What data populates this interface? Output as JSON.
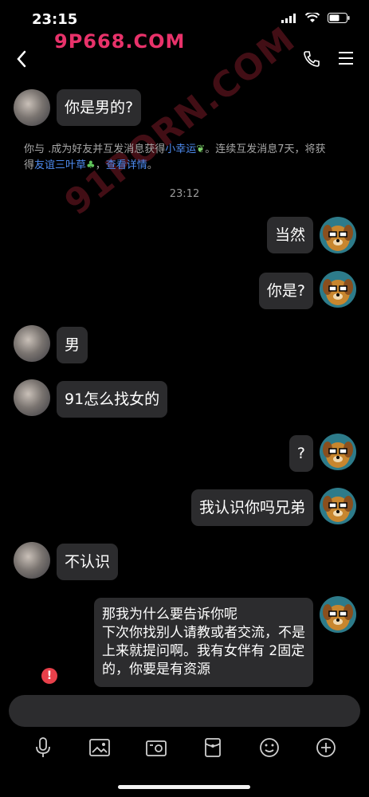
{
  "status_bar": {
    "time": "23:15"
  },
  "watermarks": {
    "top": "9P668.COM",
    "diagonal": "91PORN.COM"
  },
  "chat": {
    "messages": [
      {
        "side": "left",
        "text": "你是男的?"
      },
      {
        "side": "right",
        "text": "当然"
      },
      {
        "side": "right",
        "text": "你是?"
      },
      {
        "side": "left",
        "text": "男"
      },
      {
        "side": "left",
        "text": "91怎么找女的"
      },
      {
        "side": "right",
        "text": "?"
      },
      {
        "side": "right",
        "text": "我认识你吗兄弟"
      },
      {
        "side": "left",
        "text": "不认识"
      },
      {
        "side": "right",
        "lines": [
          "那我为什么要告诉你呢",
          "下次你找别人请教或者交流，不是",
          "上来就提问啊。我有女伴有 2固定",
          "的，你要是有资源"
        ],
        "failed": true
      }
    ],
    "system_note": {
      "part1": "你与 .成为好友并互发消息获得",
      "link1": "小幸运",
      "part2": "。连续互发消息7天，将获",
      "part3": "得",
      "link2": "友谊三叶草",
      "part4": "，",
      "link3": "查看详情",
      "part5": "。"
    },
    "timestamp": "23:12"
  },
  "colors": {
    "background": "#000000",
    "bubble": "#2c2c2e",
    "link": "#4e8cf1",
    "error": "#e8404a",
    "watermark": "#e8326a"
  },
  "icons": {
    "nav": [
      "back-arrow-icon",
      "phone-icon",
      "menu-icon"
    ],
    "toolbar": [
      "microphone-icon",
      "image-icon",
      "camera-icon",
      "red-packet-icon",
      "emoji-icon",
      "plus-icon"
    ]
  }
}
